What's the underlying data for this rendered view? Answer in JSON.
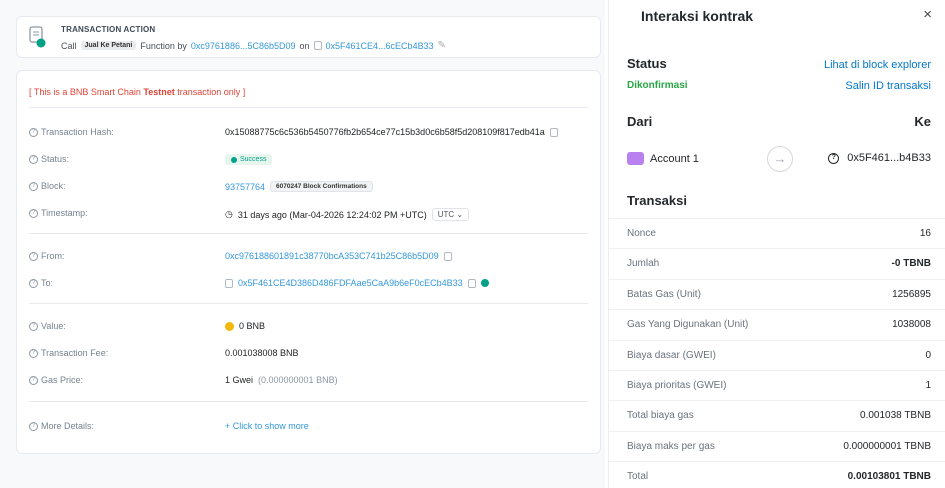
{
  "explorer": {
    "tx_action": {
      "title": "TRANSACTION ACTION",
      "call": "Call",
      "method": "Jual Ke Petani",
      "function_by": "Function by",
      "from_short": "0xc9761886...5C86b5D09",
      "on": "on",
      "to_short": "0x5F461CE4...6cECb4B33"
    },
    "testnet_prefix": "[ This is a BNB Smart Chain ",
    "testnet_word": "Testnet",
    "testnet_suffix": " transaction only ]",
    "rows": {
      "hash": {
        "label": "Transaction Hash:",
        "value": "0x15088775c6c536b5450776fb2b654ce77c15b3d0c6b58f5d208109f817edb41a"
      },
      "status": {
        "label": "Status:",
        "value": "Success"
      },
      "block": {
        "label": "Block:",
        "value": "93757764",
        "confirmations": "6070247 Block Confirmations"
      },
      "timestamp": {
        "label": "Timestamp:",
        "value": "31 days ago (Mar-04-2026 12:24:02 PM +UTC)",
        "tz": "UTC"
      },
      "from": {
        "label": "From:",
        "value": "0xc976188601891c38770bcA353C741b25C86b5D09"
      },
      "to": {
        "label": "To:",
        "value": "0x5F461CE4D386D486FDFAae5CaA9b6eF0cECb4B33"
      },
      "value": {
        "label": "Value:",
        "value": "0 BNB"
      },
      "fee": {
        "label": "Transaction Fee:",
        "value": "0.001038008 BNB"
      },
      "gas_price": {
        "label": "Gas Price:",
        "value": "1 Gwei",
        "detail": "(0.000000001 BNB)"
      },
      "more": {
        "label": "More Details:",
        "value": "+ Click to show more"
      }
    }
  },
  "wallet": {
    "title": "Interaksi kontrak",
    "close": "×",
    "status_heading": "Status",
    "status_value": "Dikonfirmasi",
    "explorer_link": "Lihat di block explorer",
    "copy_link": "Salin ID transaksi",
    "from_heading": "Dari",
    "to_heading": "Ke",
    "account_name": "Account 1",
    "to_address": "0x5F461...b4B33",
    "tx_heading": "Transaksi",
    "rows": [
      {
        "key": "Nonce",
        "value": "16"
      },
      {
        "key": "Jumlah",
        "value": "-0 TBNB"
      },
      {
        "key": "Batas Gas (Unit)",
        "value": "1256895"
      },
      {
        "key": "Gas Yang Digunakan (Unit)",
        "value": "1038008"
      },
      {
        "key": "Biaya dasar (GWEI)",
        "value": "0"
      },
      {
        "key": "Biaya prioritas (GWEI)",
        "value": "1"
      },
      {
        "key": "Total biaya gas",
        "value": "0.001038 TBNB"
      },
      {
        "key": "Biaya maks per gas",
        "value": "0.000000001 TBNB"
      },
      {
        "key": "Total",
        "value": "0.00103801 TBNB"
      }
    ]
  }
}
